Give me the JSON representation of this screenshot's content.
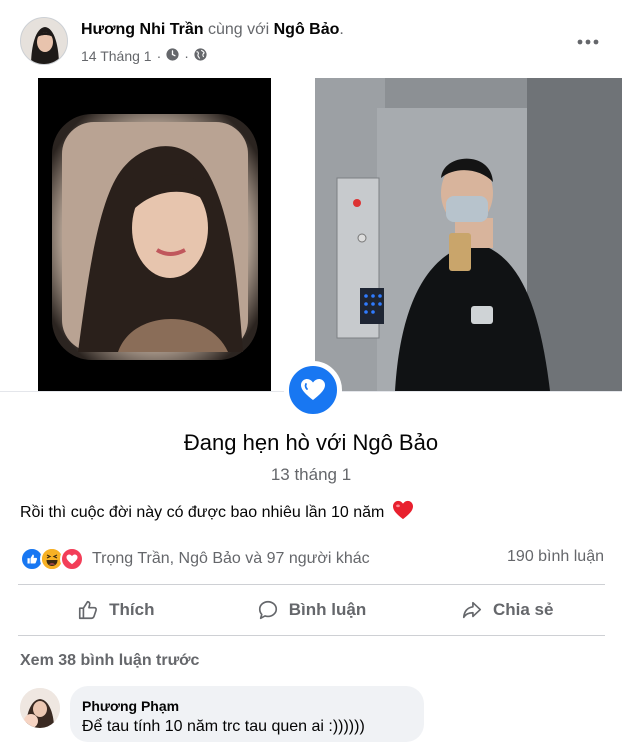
{
  "post": {
    "author": "Hương Nhi Trần",
    "with_word": "cùng với",
    "tagged": "Ngô Bảo",
    "period": ".",
    "date": "14 Tháng 1",
    "dot": "·",
    "icons": {
      "more": "more-horizontal-icon",
      "clock": "clock-icon",
      "globe": "globe-icon"
    }
  },
  "life_event": {
    "title": "Đang hẹn hò với Ngô Bảo",
    "date": "13 tháng 1",
    "icon": "heart-badge-icon",
    "badge_color": "#1877f2"
  },
  "caption": {
    "text": "Rồi thì cuộc đời này có được bao nhiêu lần 10 năm",
    "emoji": "heart-emoji-icon"
  },
  "reactions": {
    "types": [
      "like-reaction-icon",
      "haha-reaction-icon",
      "love-reaction-icon"
    ],
    "summary": "Trọng Trần, Ngô Bảo và 97 người khác",
    "comment_count": "190 bình luận"
  },
  "actions": {
    "like": "Thích",
    "comment": "Bình luận",
    "share": "Chia sẻ"
  },
  "comments": {
    "view_previous": "Xem 38 bình luận trước",
    "items": [
      {
        "name": "Phương Phạm",
        "text": "Để tau tính 10 năm trc tau quen ai :))))))"
      }
    ]
  },
  "colors": {
    "secondary_text": "#65676b",
    "primary_text": "#050505",
    "brand_blue": "#1877f2",
    "comment_bg": "#f0f2f5"
  }
}
